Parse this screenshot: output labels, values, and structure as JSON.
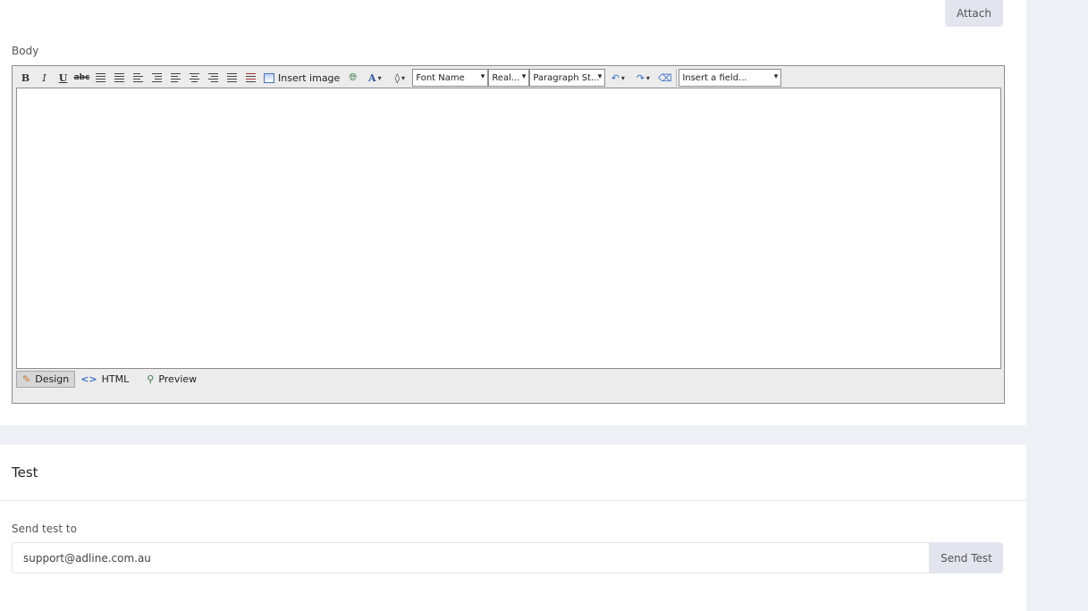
{
  "attach_button": "Attach",
  "body_label": "Body",
  "editor": {
    "toolbar": {
      "bold": "B",
      "italic": "I",
      "underline": "U",
      "strike": "abc",
      "insert_image": "Insert image",
      "font_color": "A",
      "font_name": "Font Name",
      "font_size": "Real...",
      "paragraph_style": "Paragraph St...",
      "insert_field": "Insert a field..."
    },
    "modes": [
      {
        "label": "Design",
        "icon": "pencil-icon"
      },
      {
        "label": "HTML",
        "icon": "code-icon"
      },
      {
        "label": "Preview",
        "icon": "magnifier-icon"
      }
    ]
  },
  "test_section": {
    "title": "Test",
    "send_to_label": "Send test to",
    "email_value": "support@adline.com.au",
    "send_button": "Send Test"
  },
  "colors": {
    "page_bg": "#eef0f5",
    "button_bg": "#e3e5ee"
  }
}
